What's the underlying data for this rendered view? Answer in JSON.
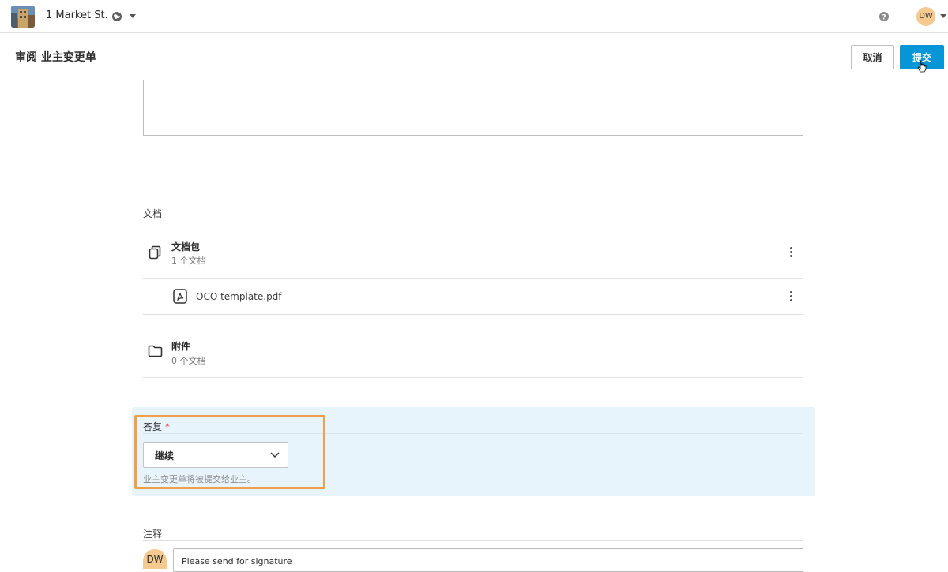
{
  "topbar": {
    "project_name": "1 Market St.",
    "avatar_initials": "DW",
    "icons": [
      "project-thumbnail",
      "globe-icon",
      "chevron-down-icon",
      "help-icon"
    ]
  },
  "header": {
    "title": "审阅 业主变更单",
    "cancel_label": "取消",
    "submit_label": "提交"
  },
  "documents": {
    "section_label": "文档",
    "package": {
      "title": "文档包",
      "count": "1 个文档"
    },
    "files": [
      {
        "name": "OCO template.pdf"
      }
    ],
    "attachments": {
      "title": "附件",
      "count": "0 个文档"
    }
  },
  "reply": {
    "label": "答复",
    "required_mark": "*",
    "selected_value": "继续",
    "help_text": "业主变更单将被提交给业主。"
  },
  "comments": {
    "section_label": "注释",
    "avatar_initials": "DW",
    "comment_text": "Please send for signature"
  },
  "colors": {
    "accent": "#0696d7",
    "reply_panel_bg": "#e8f4fb",
    "highlight": "#f0a04b",
    "avatar_bg": "#f6c98f"
  }
}
